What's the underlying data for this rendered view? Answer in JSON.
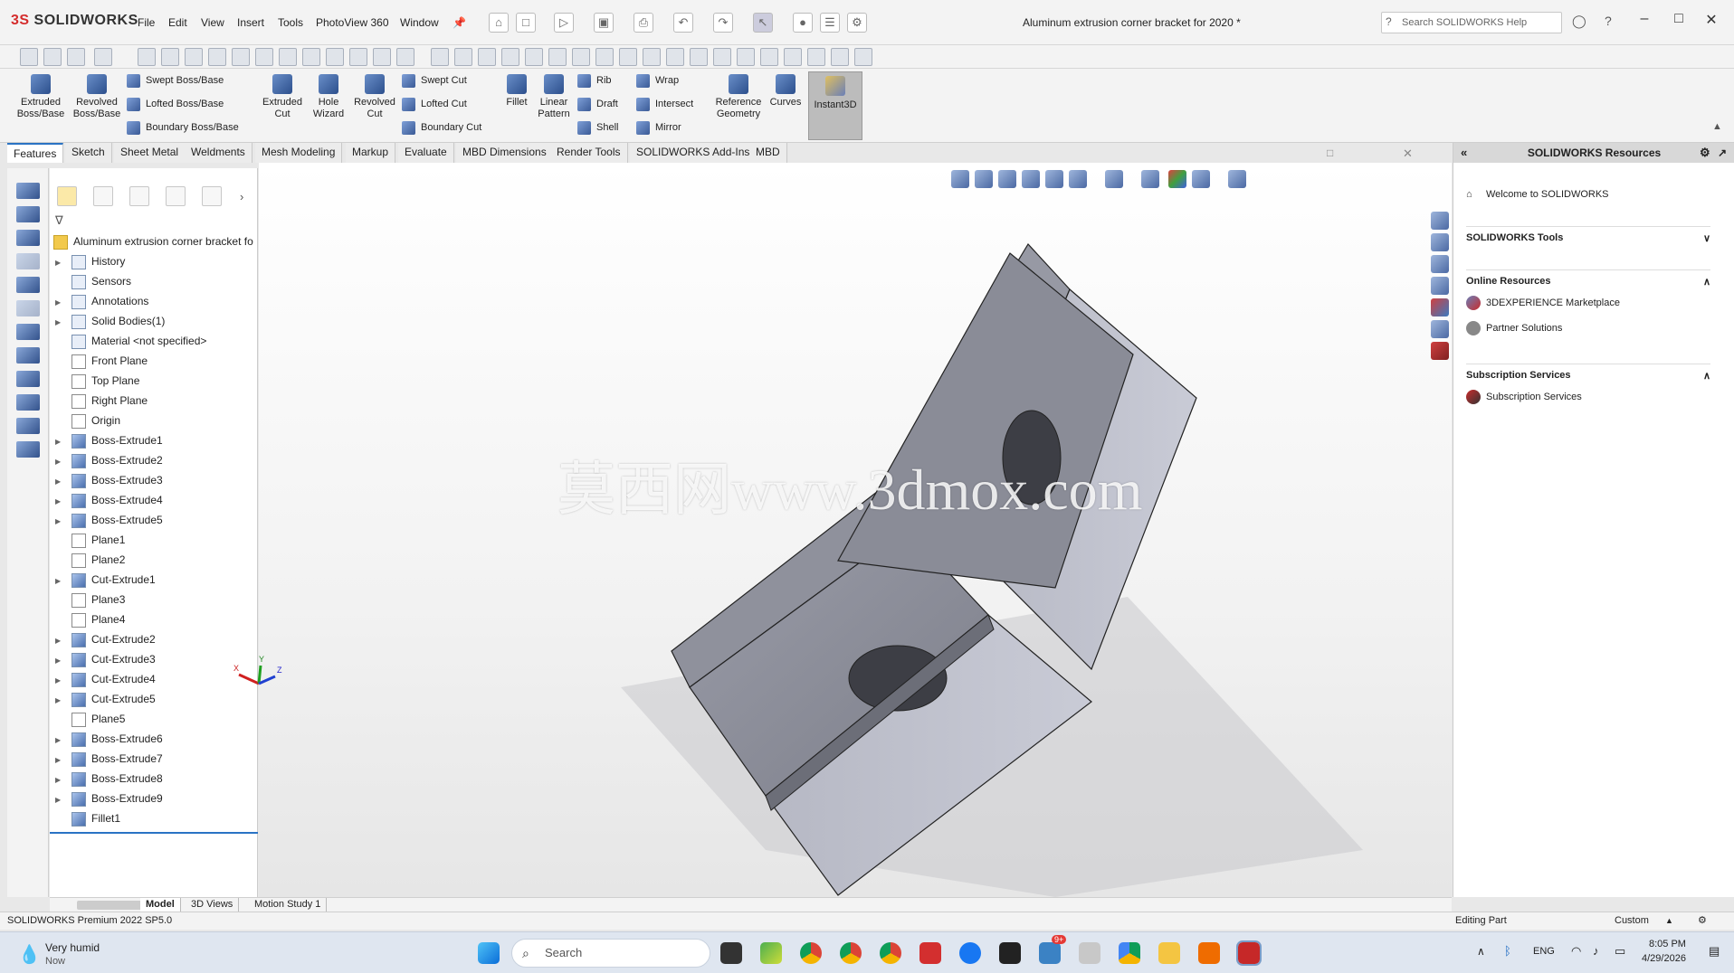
{
  "title_bar": {
    "logo_brand": "3S",
    "logo_text": "SOLIDWORKS",
    "menu": [
      "File",
      "Edit",
      "View",
      "Insert",
      "Tools",
      "PhotoView 360",
      "Window"
    ],
    "document_title": "Aluminum extrusion corner bracket for 2020 *",
    "help_search_placeholder": "Search SOLIDWORKS Help",
    "window_controls": [
      "minimize-icon",
      "maximize-icon",
      "close-icon"
    ]
  },
  "ribbon": {
    "large_buttons": [
      {
        "label_1": "Extruded",
        "label_2": "Boss/Base",
        "icon": "extruded-boss-icon"
      },
      {
        "label_1": "Revolved",
        "label_2": "Boss/Base",
        "icon": "revolved-boss-icon"
      },
      {
        "label_1": "Extruded",
        "label_2": "Cut",
        "icon": "extruded-cut-icon"
      },
      {
        "label_1": "Hole",
        "label_2": "Wizard",
        "icon": "hole-wizard-icon"
      },
      {
        "label_1": "Revolved",
        "label_2": "Cut",
        "icon": "revolved-cut-icon"
      },
      {
        "label_1": "Fillet",
        "label_2": "",
        "icon": "fillet-icon"
      },
      {
        "label_1": "Linear",
        "label_2": "Pattern",
        "icon": "linear-pattern-icon"
      },
      {
        "label_1": "Reference",
        "label_2": "Geometry",
        "icon": "reference-geometry-icon"
      },
      {
        "label_1": "Curves",
        "label_2": "",
        "icon": "curves-icon"
      }
    ],
    "small_boss": [
      "Swept Boss/Base",
      "Lofted Boss/Base",
      "Boundary Boss/Base"
    ],
    "small_cut": [
      "Swept Cut",
      "Lofted Cut",
      "Boundary Cut"
    ],
    "small_features": [
      "Rib",
      "Draft",
      "Shell"
    ],
    "small_more": [
      "Wrap",
      "Intersect",
      "Mirror"
    ],
    "instant3d": "Instant3D"
  },
  "tabs": [
    "Features",
    "Sketch",
    "Sheet Metal",
    "Weldments",
    "Mesh Modeling",
    "Markup",
    "Evaluate",
    "MBD Dimensions",
    "Render Tools",
    "SOLIDWORKS Add-Ins",
    "MBD"
  ],
  "active_tab": "Features",
  "feature_tree": {
    "root": "Aluminum extrusion corner bracket fo",
    "nodes": [
      {
        "label": "History",
        "expandable": true,
        "kind": "folder"
      },
      {
        "label": "Sensors",
        "expandable": false,
        "kind": "folder"
      },
      {
        "label": "Annotations",
        "expandable": true,
        "kind": "folder"
      },
      {
        "label": "Solid Bodies(1)",
        "expandable": true,
        "kind": "folder"
      },
      {
        "label": "Material <not specified>",
        "expandable": false,
        "kind": "folder"
      },
      {
        "label": "Front Plane",
        "expandable": false,
        "kind": "plane"
      },
      {
        "label": "Top Plane",
        "expandable": false,
        "kind": "plane"
      },
      {
        "label": "Right Plane",
        "expandable": false,
        "kind": "plane"
      },
      {
        "label": "Origin",
        "expandable": false,
        "kind": "plane"
      },
      {
        "label": "Boss-Extrude1",
        "expandable": true,
        "kind": "feat"
      },
      {
        "label": "Boss-Extrude2",
        "expandable": true,
        "kind": "feat"
      },
      {
        "label": "Boss-Extrude3",
        "expandable": true,
        "kind": "feat"
      },
      {
        "label": "Boss-Extrude4",
        "expandable": true,
        "kind": "feat"
      },
      {
        "label": "Boss-Extrude5",
        "expandable": true,
        "kind": "feat"
      },
      {
        "label": "Plane1",
        "expandable": false,
        "kind": "plane"
      },
      {
        "label": "Plane2",
        "expandable": false,
        "kind": "plane"
      },
      {
        "label": "Cut-Extrude1",
        "expandable": true,
        "kind": "feat"
      },
      {
        "label": "Plane3",
        "expandable": false,
        "kind": "plane"
      },
      {
        "label": "Plane4",
        "expandable": false,
        "kind": "plane"
      },
      {
        "label": "Cut-Extrude2",
        "expandable": true,
        "kind": "feat"
      },
      {
        "label": "Cut-Extrude3",
        "expandable": true,
        "kind": "feat"
      },
      {
        "label": "Cut-Extrude4",
        "expandable": true,
        "kind": "feat"
      },
      {
        "label": "Cut-Extrude5",
        "expandable": true,
        "kind": "feat"
      },
      {
        "label": "Plane5",
        "expandable": false,
        "kind": "plane"
      },
      {
        "label": "Boss-Extrude6",
        "expandable": true,
        "kind": "feat"
      },
      {
        "label": "Boss-Extrude7",
        "expandable": true,
        "kind": "feat"
      },
      {
        "label": "Boss-Extrude8",
        "expandable": true,
        "kind": "feat"
      },
      {
        "label": "Boss-Extrude9",
        "expandable": true,
        "kind": "feat"
      },
      {
        "label": "Fillet1",
        "expandable": false,
        "kind": "feat"
      }
    ]
  },
  "viewport": {
    "watermark": "莫西网www.3dmox.com",
    "triad_labels": [
      "X",
      "Y",
      "Z"
    ]
  },
  "resources_panel": {
    "title": "SOLIDWORKS Resources",
    "welcome": "Welcome to SOLIDWORKS",
    "tools_section": "SOLIDWORKS Tools",
    "online_section": "Online Resources",
    "online_items": [
      "3DEXPERIENCE Marketplace",
      "Partner Solutions"
    ],
    "subscription_section": "Subscription Services",
    "subscription_items": [
      "Subscription Services"
    ]
  },
  "bottom_tabs": [
    "Model",
    "3D Views",
    "Motion Study 1"
  ],
  "status_bar": {
    "version": "SOLIDWORKS Premium 2022 SP5.0",
    "mode": "Editing Part",
    "units": "Custom"
  },
  "taskbar": {
    "weather_title": "Very humid",
    "weather_sub": "Now",
    "search_placeholder": "Search",
    "language": "ENG",
    "time": "8:05 PM",
    "date": "4/29/2026",
    "notification_badge": "9+"
  },
  "colors": {
    "accent": "#2a73c4",
    "brand_red": "#d42c2c",
    "model_gray": "#8a8c96"
  }
}
